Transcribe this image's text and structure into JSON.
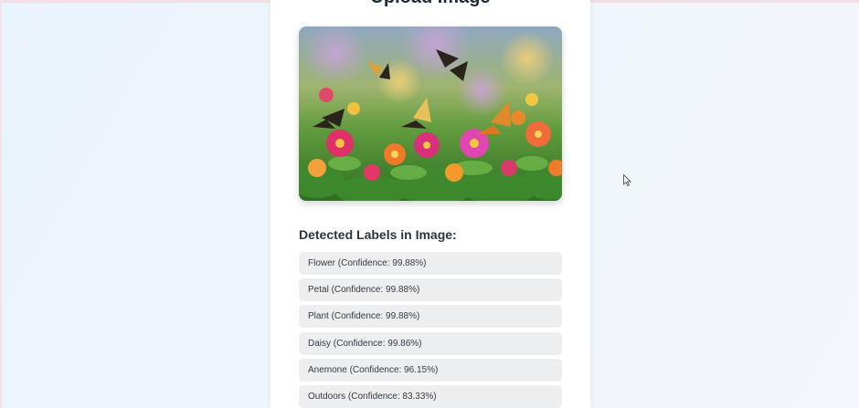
{
  "page": {
    "title": "Upload Image"
  },
  "image": {
    "alt": "Butterflies on colorful zinnia flowers"
  },
  "labels_section": {
    "heading": "Detected Labels in Image:",
    "items": [
      "Flower (Confidence: 99.88%)",
      "Petal (Confidence: 99.88%)",
      "Plant (Confidence: 99.88%)",
      "Daisy (Confidence: 99.86%)",
      "Anemone (Confidence: 96.15%)",
      "Outdoors (Confidence: 83.33%)"
    ]
  },
  "colors": {
    "label_bg": "#eceeef",
    "heading": "#2b3440",
    "background": "#eef5fc"
  }
}
